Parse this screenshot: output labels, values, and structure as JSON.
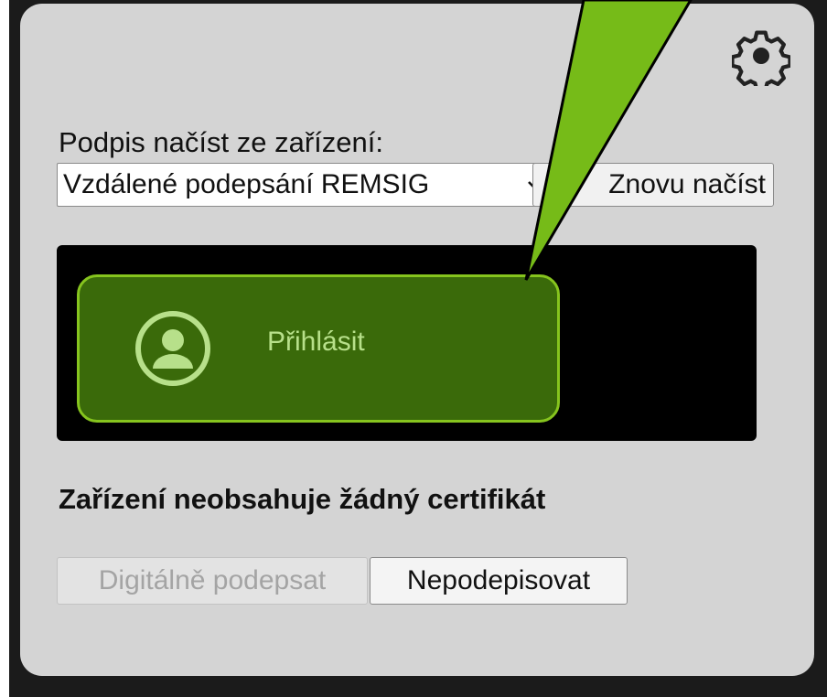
{
  "dialog": {
    "device_label": "Podpis načíst ze zařízení:",
    "device_select": {
      "selected": "Vzdálené podepsání REMSIG"
    },
    "reload_button": "Znovu načíst",
    "login_button": "Přihlásit",
    "status_message": "Zařízení neobsahuje žádný certifikát",
    "sign_button": "Digitálně podepsat",
    "no_sign_button": "Nepodepisovat"
  },
  "icons": {
    "settings": "gear-icon",
    "select_arrow": "chevron-down-icon",
    "login": "user-icon",
    "callout": "callout-pointer"
  },
  "colors": {
    "panel_background": "#d4d4d4",
    "login_button_fill": "#3a6a0a",
    "login_button_border": "#86c41e",
    "login_button_text": "#b7e08a",
    "callout_fill": "#76bb18",
    "dark_area": "#000000"
  }
}
